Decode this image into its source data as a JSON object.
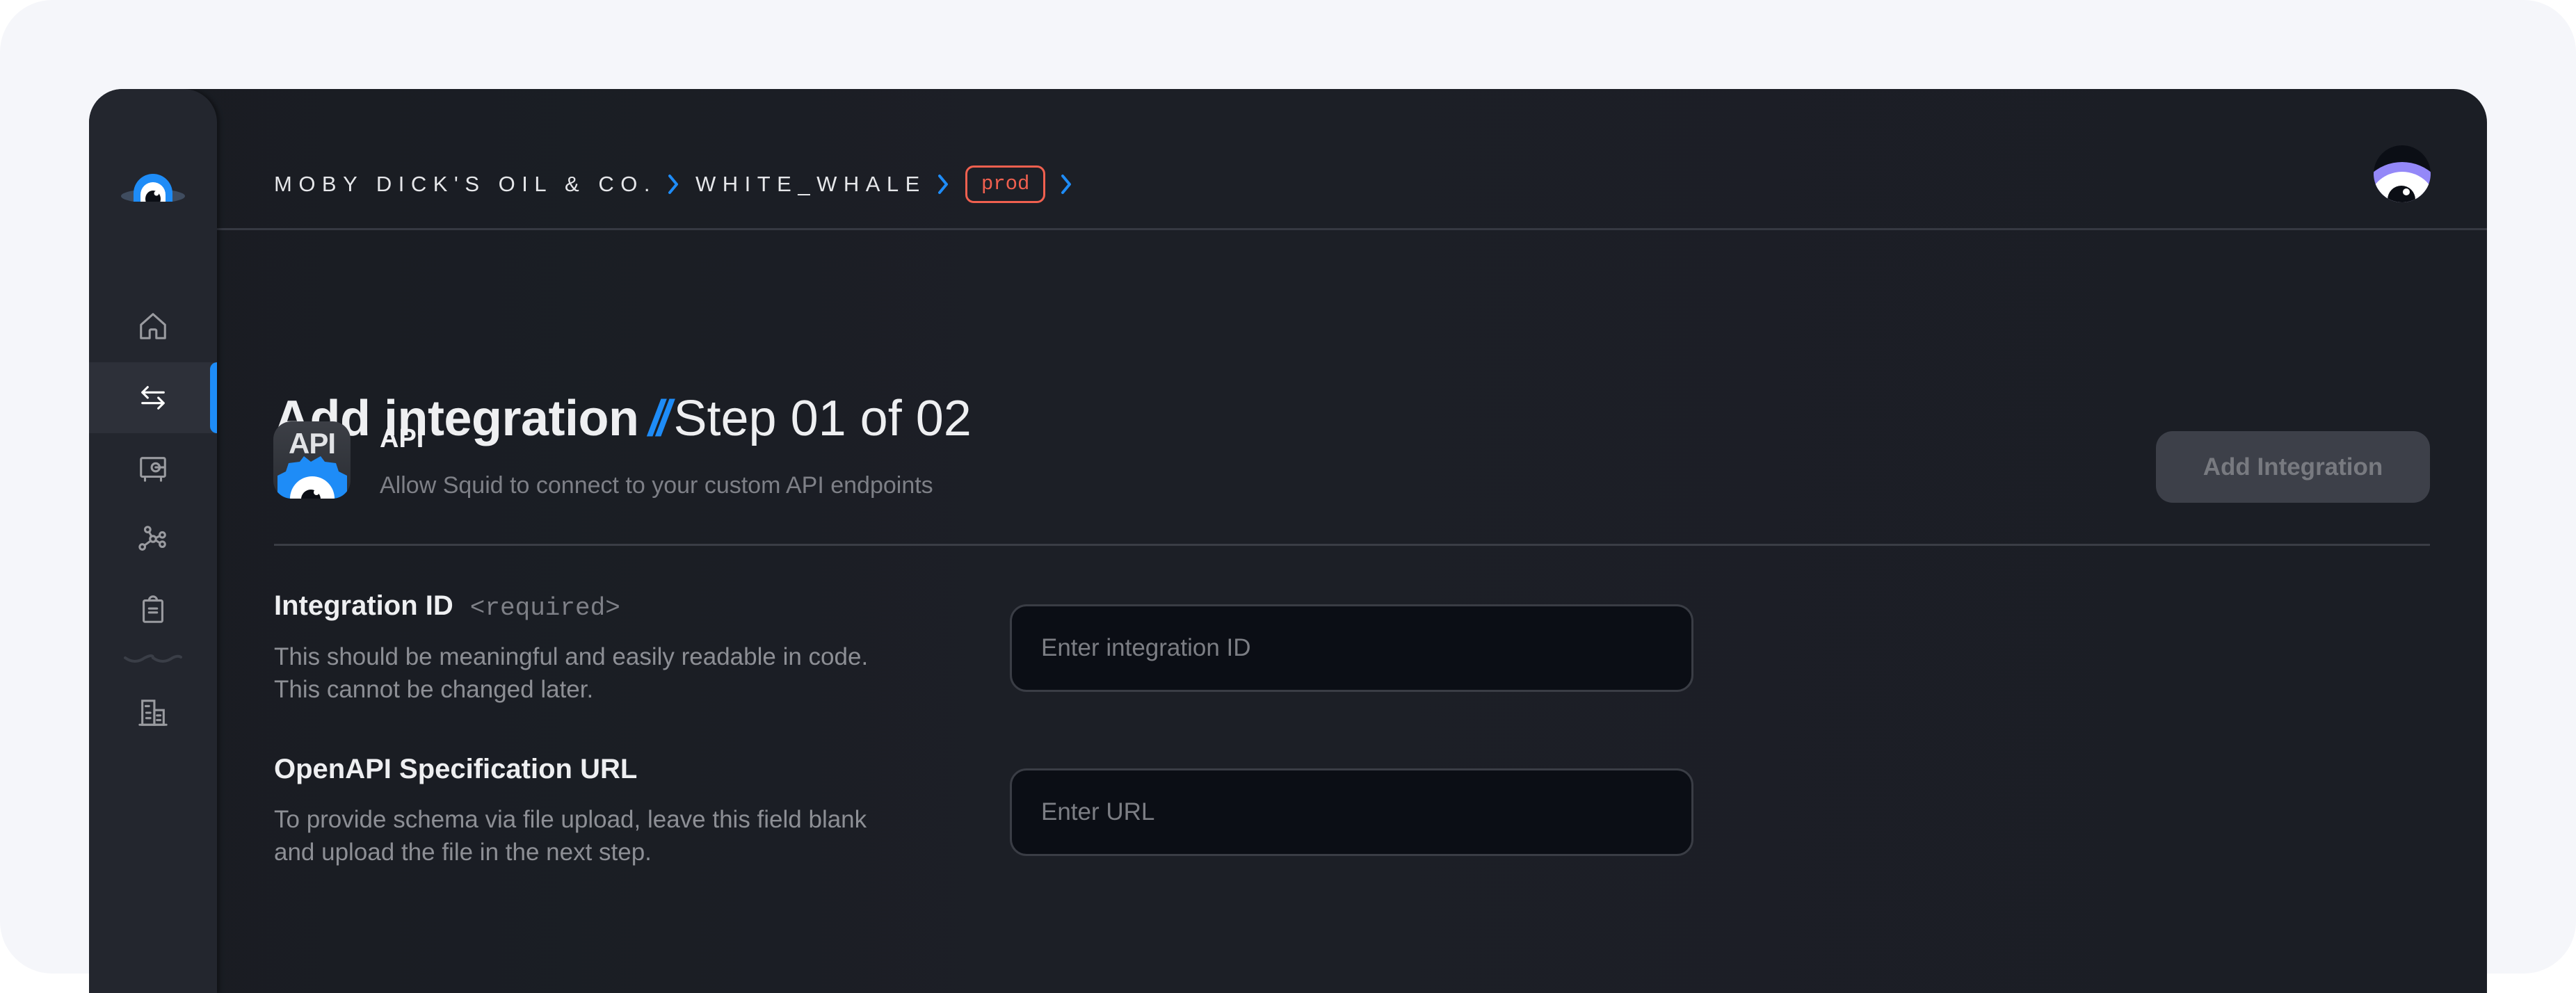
{
  "breadcrumb": {
    "organization": "MOBY DICK'S OIL & CO.",
    "application": "WHITE_WHALE",
    "environment": "prod"
  },
  "sidebar": {
    "items": [
      {
        "name": "home",
        "icon": "home-icon",
        "active": false
      },
      {
        "name": "integrations",
        "icon": "arrows-left-right-icon",
        "active": true
      },
      {
        "name": "secrets",
        "icon": "safe-icon",
        "active": false
      },
      {
        "name": "graph",
        "icon": "network-icon",
        "active": false
      },
      {
        "name": "logs",
        "icon": "clipboard-icon",
        "active": false
      },
      {
        "name": "organization",
        "icon": "building-icon",
        "active": false
      }
    ]
  },
  "page": {
    "title": "Add integration",
    "separator": "//",
    "step": "Step 01 of 02"
  },
  "integration": {
    "icon_text": "API",
    "name": "API",
    "description": "Allow Squid to connect to your custom API endpoints",
    "add_button_label": "Add Integration"
  },
  "form": {
    "fields": [
      {
        "label": "Integration ID",
        "required_tag": "<required>",
        "help_lines": [
          "This should be meaningful and easily readable in code.",
          "This cannot be changed later."
        ],
        "value": "",
        "placeholder": "Enter integration ID"
      },
      {
        "label": "OpenAPI Specification URL",
        "help_lines": [
          "To provide schema via file upload, leave this field blank",
          "and upload the file in the next step."
        ],
        "value": "",
        "placeholder": "Enter URL"
      }
    ]
  },
  "colors": {
    "accent": "#1e8cf7",
    "env_badge": "#f0604f",
    "avatar": "#9488f8",
    "window_bg": "#1b1e25",
    "sidebar_bg": "#23262e"
  }
}
